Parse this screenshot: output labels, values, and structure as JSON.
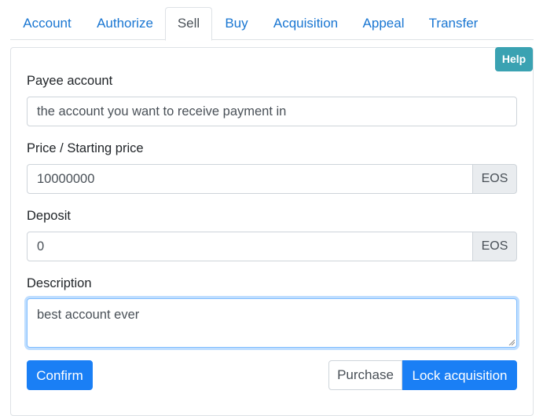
{
  "tabs": [
    {
      "label": "Account"
    },
    {
      "label": "Authorize"
    },
    {
      "label": "Sell"
    },
    {
      "label": "Buy"
    },
    {
      "label": "Acquisition"
    },
    {
      "label": "Appeal"
    },
    {
      "label": "Transfer"
    }
  ],
  "active_tab": "Sell",
  "help_label": "Help",
  "form": {
    "payee": {
      "label": "Payee account",
      "placeholder": "the account you want to receive payment in",
      "value": ""
    },
    "price": {
      "label": "Price / Starting price",
      "value": "10000000",
      "unit": "EOS"
    },
    "deposit": {
      "label": "Deposit",
      "value": "0",
      "unit": "EOS"
    },
    "description": {
      "label": "Description",
      "value": "best account ever"
    }
  },
  "buttons": {
    "confirm": "Confirm",
    "purchase": "Purchase",
    "lock_acquisition": "Lock acquisition"
  },
  "colors": {
    "link": "#1976d2",
    "primary": "#1a7ff5",
    "help": "#3aa2b2"
  }
}
